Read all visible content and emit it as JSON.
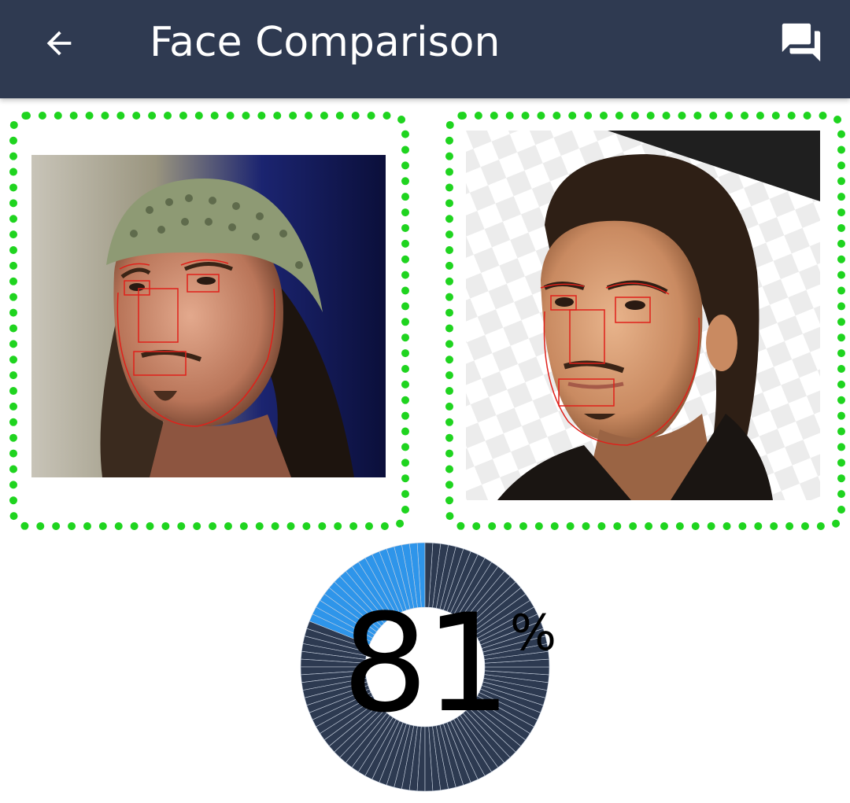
{
  "header": {
    "title": "Face Comparison",
    "back_icon": "arrow-back-icon",
    "feedback_icon": "chat-bubbles-icon",
    "background_color": "#2f3a51"
  },
  "faces": [
    {
      "name": "left-face",
      "detection_box_color": "#e0201a",
      "border_color": "#1fd41f"
    },
    {
      "name": "right-face",
      "detection_box_color": "#e0201a",
      "border_color": "#1fd41f"
    }
  ],
  "similarity": {
    "value": "81",
    "unit": "%",
    "fraction": 0.19,
    "ring_filled_color": "#2e95ea",
    "ring_empty_color": "#2d3a51"
  }
}
